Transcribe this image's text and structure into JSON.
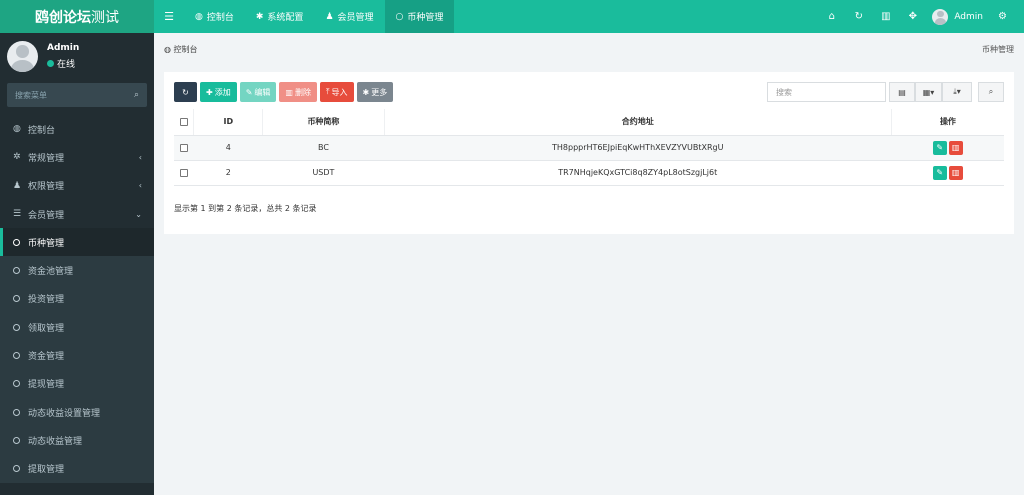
{
  "logo": {
    "bold": "鸥创论坛",
    "thin": "测试"
  },
  "topnav": [
    {
      "icon": "dashboard-icon",
      "glyph": "◍",
      "label": "控制台"
    },
    {
      "icon": "gear-icon",
      "glyph": "✱",
      "label": "系统配置"
    },
    {
      "icon": "user-icon",
      "glyph": "♟",
      "label": "会员管理"
    },
    {
      "icon": "circle-icon",
      "glyph": "○",
      "label": "币种管理"
    }
  ],
  "topright": {
    "username": "Admin"
  },
  "user": {
    "name": "Admin",
    "status": "在线"
  },
  "sidebar": {
    "search_placeholder": "搜索菜单",
    "items": [
      {
        "label": "控制台"
      },
      {
        "label": "常规管理"
      },
      {
        "label": "权限管理"
      },
      {
        "label": "会员管理"
      },
      {
        "label": "币种管理"
      },
      {
        "label": "资金池管理"
      },
      {
        "label": "投资管理"
      },
      {
        "label": "领取管理"
      },
      {
        "label": "资金管理"
      },
      {
        "label": "提现管理"
      },
      {
        "label": "动态收益设置管理"
      },
      {
        "label": "动态收益管理"
      },
      {
        "label": "提取管理"
      }
    ]
  },
  "breadcrumb": {
    "home": "控制台",
    "current": "币种管理"
  },
  "toolbar": {
    "add": "添加",
    "edit": "编辑",
    "delete": "删除",
    "import": "导入",
    "more": "更多",
    "search_placeholder": "搜索"
  },
  "table": {
    "headers": [
      "ID",
      "币种简称",
      "合约地址",
      "操作"
    ],
    "rows": [
      {
        "id": "4",
        "symbol": "BC",
        "address": "TH8ppprHT6EJpiEqKwHThXEVZYVUBtXRgU"
      },
      {
        "id": "2",
        "symbol": "USDT",
        "address": "TR7NHqjeKQxGTCi8q8ZY4pL8otSzgjLj6t"
      }
    ]
  },
  "pagination": {
    "info": "显示第 1 到第 2 条记录，总共 2 条记录"
  },
  "colors": {
    "accent": "#1abc9c",
    "sidebar": "#222d32",
    "danger": "#e74c3c",
    "dark": "#2c3e50"
  }
}
